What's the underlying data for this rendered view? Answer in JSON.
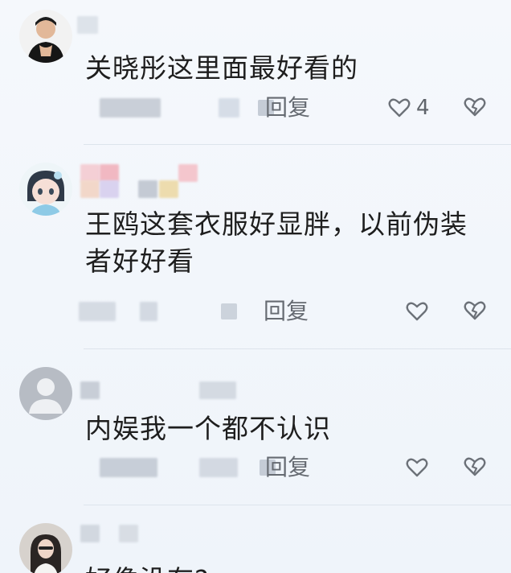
{
  "comments": [
    {
      "text": "关晓彤这里面最好看的",
      "reply_label": "回复",
      "like_count": "4",
      "avatar_icon": "avatar-man-icon"
    },
    {
      "text": "王鸥这套衣服好显胖，以前伪装者好好看",
      "reply_label": "回复",
      "like_count": "",
      "avatar_icon": "avatar-anime-girl-icon"
    },
    {
      "text": "内娱我一个都不认识",
      "reply_label": "回复",
      "like_count": "",
      "avatar_icon": "default-avatar-icon"
    },
    {
      "text": "好像没有?",
      "reply_label": "",
      "like_count": "",
      "avatar_icon": "avatar-woman-icon"
    }
  ],
  "colors": {
    "background": "#f3f7fb",
    "text": "#1e1e1e",
    "muted": "#666b72",
    "icon": "#6c7178"
  }
}
